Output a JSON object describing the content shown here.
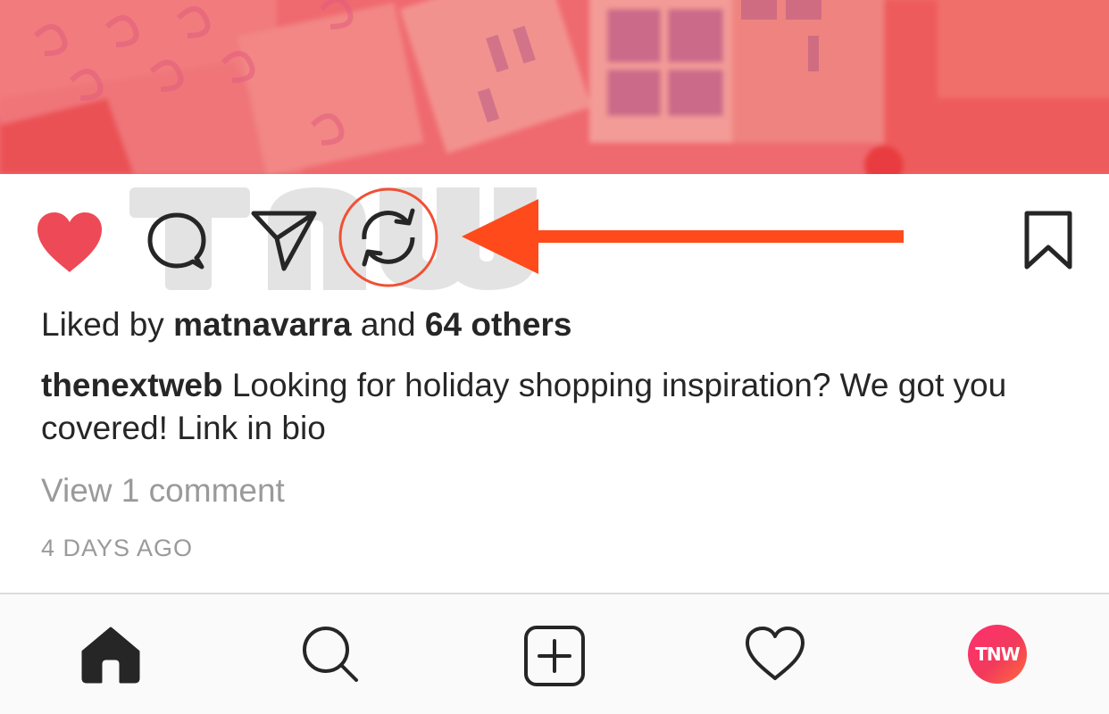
{
  "post": {
    "image": {
      "tint": "#ef6a6f"
    },
    "watermark": {
      "text": "TNW",
      "color": "#e3e3e3"
    },
    "actions": [
      {
        "id": "like",
        "icon": "heart-filled-icon",
        "state": "liked",
        "color": "#ed4956"
      },
      {
        "id": "comment",
        "icon": "comment-bubble-icon"
      },
      {
        "id": "share",
        "icon": "paper-plane-icon"
      },
      {
        "id": "repost",
        "icon": "repost-arrows-icon",
        "highlighted": true,
        "highlight_color": "#f05033"
      },
      {
        "id": "save",
        "icon": "bookmark-outline-icon"
      }
    ],
    "annotation_arrow": {
      "color": "#ff4a1c"
    },
    "likes": {
      "prefix": "Liked by",
      "user": "matnavarra",
      "conjunction": "and",
      "others": "64 others"
    },
    "caption": {
      "username": "thenextweb",
      "text": "Looking for holiday shopping inspiration? We got you covered! Link in bio"
    },
    "view_comments": "View 1 comment",
    "timestamp": "4 DAYS AGO"
  },
  "tab_bar": {
    "tabs": [
      {
        "id": "home",
        "icon": "home-filled-icon",
        "active": true
      },
      {
        "id": "search",
        "icon": "search-icon"
      },
      {
        "id": "new-post",
        "icon": "plus-square-icon"
      },
      {
        "id": "activity",
        "icon": "heart-outline-icon"
      },
      {
        "id": "profile",
        "icon": "profile-avatar-icon",
        "avatar_text": "TNW"
      }
    ]
  }
}
